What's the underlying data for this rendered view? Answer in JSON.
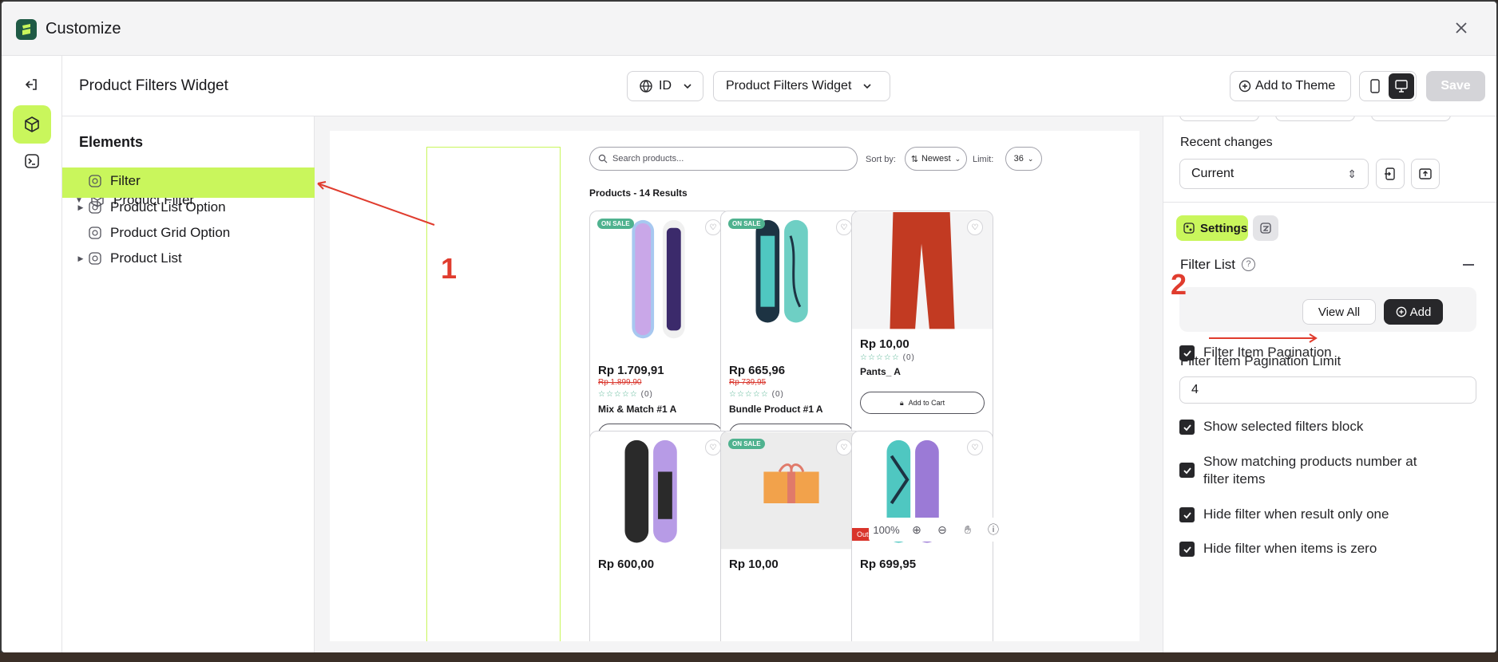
{
  "window": {
    "title": "Customize"
  },
  "header": {
    "page_title": "Product Filters Widget",
    "language": "ID",
    "widget_select": "Product Filters Widget",
    "add_to_theme": "Add to Theme",
    "save": "Save"
  },
  "elements": {
    "title": "Elements",
    "tree": [
      {
        "label": "Product Filter"
      },
      {
        "label": "Filter"
      },
      {
        "label": "Product List Option"
      },
      {
        "label": "Product Grid Option"
      },
      {
        "label": "Product List"
      }
    ]
  },
  "preview": {
    "search_placeholder": "Search products...",
    "sort_label": "Sort by:",
    "sort_value": "Newest",
    "limit_label": "Limit:",
    "limit_value": "36",
    "results": "Products - 14 Results",
    "add_to_cart": "Add to Cart",
    "zoom": "100%",
    "products": [
      {
        "price": "Rp 1.709,91",
        "old_price": "Rp 1.899,90",
        "badge": "ON SALE",
        "name": "Mix & Match #1 A",
        "reviews": "(0)"
      },
      {
        "price": "Rp 665,96",
        "old_price": "Rp 739,95",
        "badge": "ON SALE",
        "name": "Bundle Product #1 A",
        "reviews": "(0)"
      },
      {
        "price": "Rp 10,00",
        "name": "Pants_ A",
        "reviews": "(0)"
      },
      {
        "price": "Rp 600,00"
      },
      {
        "price": "Rp 10,00",
        "badge": "ON SALE"
      },
      {
        "price": "Rp 699,95",
        "status": "Out of Stock"
      }
    ]
  },
  "annotations": {
    "one": "1",
    "two": "2"
  },
  "right_panel": {
    "recent_changes_label": "Recent changes",
    "recent_changes_value": "Current",
    "settings_tab": "Settings",
    "section_title": "Filter List",
    "view_all": "View All",
    "add": "Add",
    "filter_item_pagination": "Filter Item Pagination",
    "pagination_limit_label": "Filter Item Pagination Limit",
    "pagination_limit_value": "4",
    "show_selected_filters": "Show selected filters block",
    "show_matching_line1": "Show matching products number at",
    "show_matching_line2": "filter items",
    "hide_filter_one": "Hide filter when result only one",
    "hide_filter_items_partial": "Hide filter when items is zero"
  },
  "colors": {
    "accent": "#c9f65c",
    "annotation": "#e03c2e",
    "dark_button": "#27272a",
    "sale_badge": "#4fb28f",
    "out_of_stock": "#d9342b"
  },
  "icons": [
    "app-logo-icon",
    "close-icon",
    "exit-icon",
    "cube-icon",
    "terminal-icon",
    "globe-icon",
    "chevron-down-icon",
    "plus-circle-icon",
    "mobile-icon",
    "desktop-icon",
    "search-icon",
    "sort-icon",
    "heart-icon",
    "cart-icon",
    "zoom-in-icon",
    "zoom-out-icon",
    "hand-icon",
    "help-icon",
    "import-icon",
    "export-icon",
    "settings-icon",
    "code-icon",
    "check-icon"
  ]
}
